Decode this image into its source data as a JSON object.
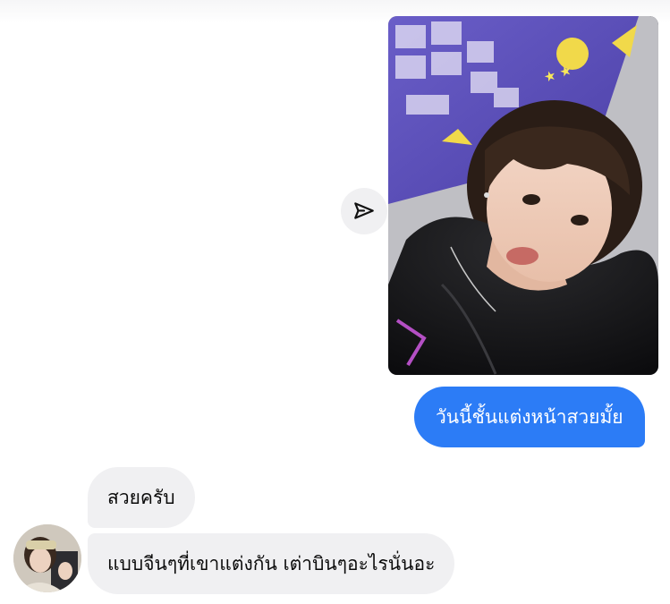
{
  "conversation": {
    "messages": [
      {
        "direction": "outgoing",
        "type": "photo",
        "description_icon": "selfie-photo"
      },
      {
        "direction": "outgoing",
        "type": "text",
        "text": "วันนี้ชั้นแต่งหน้าสวยมั้ย"
      },
      {
        "direction": "incoming",
        "type": "text",
        "text": "สวยครับ"
      },
      {
        "direction": "incoming",
        "type": "text",
        "text": "แบบจีนๆที่เขาแต่งกัน เต่าบินๆอะไรนั่นอะ"
      }
    ],
    "share_icon": "send-paper-plane-icon",
    "avatar_icon": "contact-avatar"
  },
  "colors": {
    "sent_bubble": "#2c7cf6",
    "received_bubble": "#f0f0f2",
    "background": "#ffffff"
  }
}
